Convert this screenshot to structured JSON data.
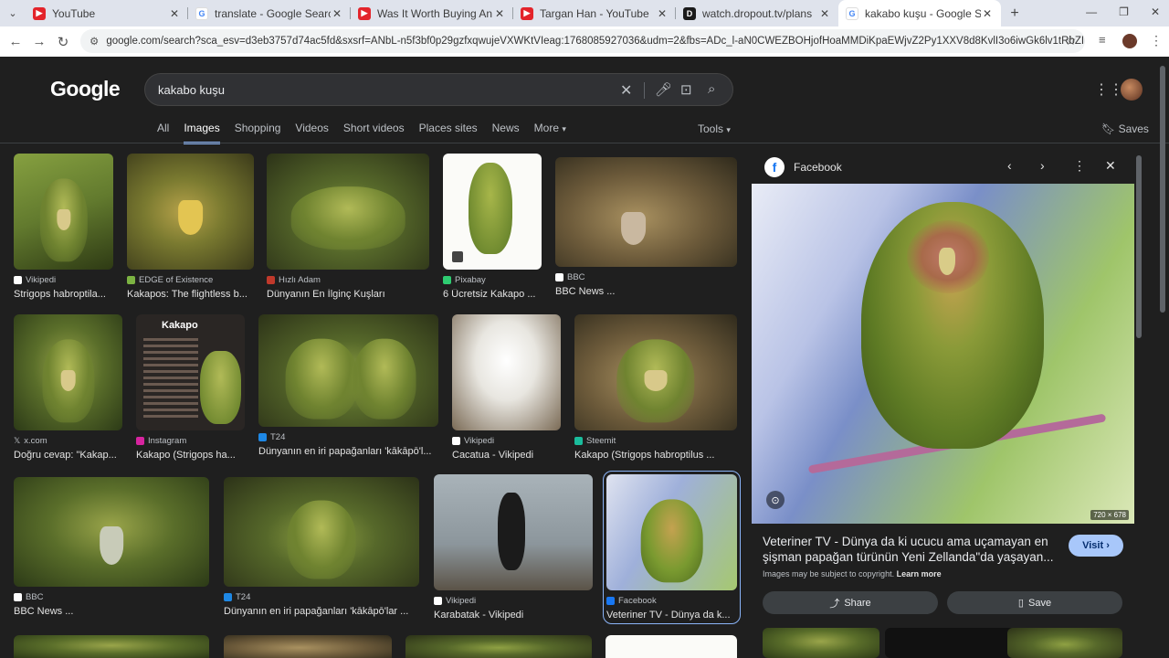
{
  "tabs": [
    {
      "title": "YouTube",
      "icon": "youtube-icon"
    },
    {
      "title": "translate - Google Search",
      "icon": "google-icon"
    },
    {
      "title": "Was It Worth Buying An Italian",
      "icon": "youtube-icon"
    },
    {
      "title": "Targan Han - YouTube",
      "icon": "youtube-icon"
    },
    {
      "title": "watch.dropout.tv/plans",
      "icon": "dropout-icon"
    },
    {
      "title": "kakabo kuşu - Google Search",
      "icon": "google-icon"
    }
  ],
  "address": {
    "url": "google.com/search?sca_esv=d3eb3757d74ac5fd&sxsrf=ANbL-n5f3bf0p29gzfxqwujeVXWKtVIeag:1768085927036&udm=2&fbs=ADc_l-aN0CWEZBOHjofHoaMMDiKpaEWjvZ2Py1XXV8d8KvlI3o6iwGk6lv1tRbZIBNIVs-5-bUj3iB..."
  },
  "search": {
    "logo": "Google",
    "query": "kakabo kuşu"
  },
  "nav": {
    "tabs": [
      "All",
      "Images",
      "Shopping",
      "Videos",
      "Short videos",
      "Places sites",
      "News",
      "More"
    ],
    "active": "Images",
    "tools": "Tools",
    "saves": "Saves"
  },
  "results": [
    {
      "source": "Vikipedi",
      "title": "Strigops habroptila..."
    },
    {
      "source": "EDGE of Existence",
      "title": "Kakapos: The flightless b..."
    },
    {
      "source": "Hızlı Adam",
      "title": "Dünyanın En İlginç Kuşları"
    },
    {
      "source": "Pixabay",
      "title": "6 Ücretsiz Kakapo ..."
    },
    {
      "source": "BBC",
      "title": "BBC News ..."
    },
    {
      "source": "x.com",
      "title": "Doğru cevap: \"Kakap..."
    },
    {
      "source": "Instagram",
      "title": "Kakapo (Strigops ha..."
    },
    {
      "source": "T24",
      "title": "Dünyanın en iri papağanları 'kākāpō'l..."
    },
    {
      "source": "Vikipedi",
      "title": "Cacatua - Vikipedi"
    },
    {
      "source": "Steemit",
      "title": "Kakapo (Strigops habroptilus ..."
    },
    {
      "source": "BBC",
      "title": "BBC News ..."
    },
    {
      "source": "T24",
      "title": "Dünyanın en iri papağanları 'kākāpō'lar ..."
    },
    {
      "source": "Vikipedi",
      "title": "Karabatak - Vikipedi"
    },
    {
      "source": "Facebook",
      "title": "Veteriner TV - Dünya da k..."
    }
  ],
  "poster": {
    "title": "Kakapo"
  },
  "panel": {
    "source": "Facebook",
    "title": "Veteriner TV - Dünya da ki ucucu ama uçamayan en şişman papağan türünün Yeni Zellanda\"da yaşayan...",
    "visit": "Visit",
    "copyright": "Images may be subject to copyright.",
    "learn_more": "Learn more",
    "share": "Share",
    "save": "Save",
    "dimensions": "720 × 678"
  },
  "colors": {
    "accent": "#8ab4f8",
    "visit_bg": "#a8c7fa"
  }
}
